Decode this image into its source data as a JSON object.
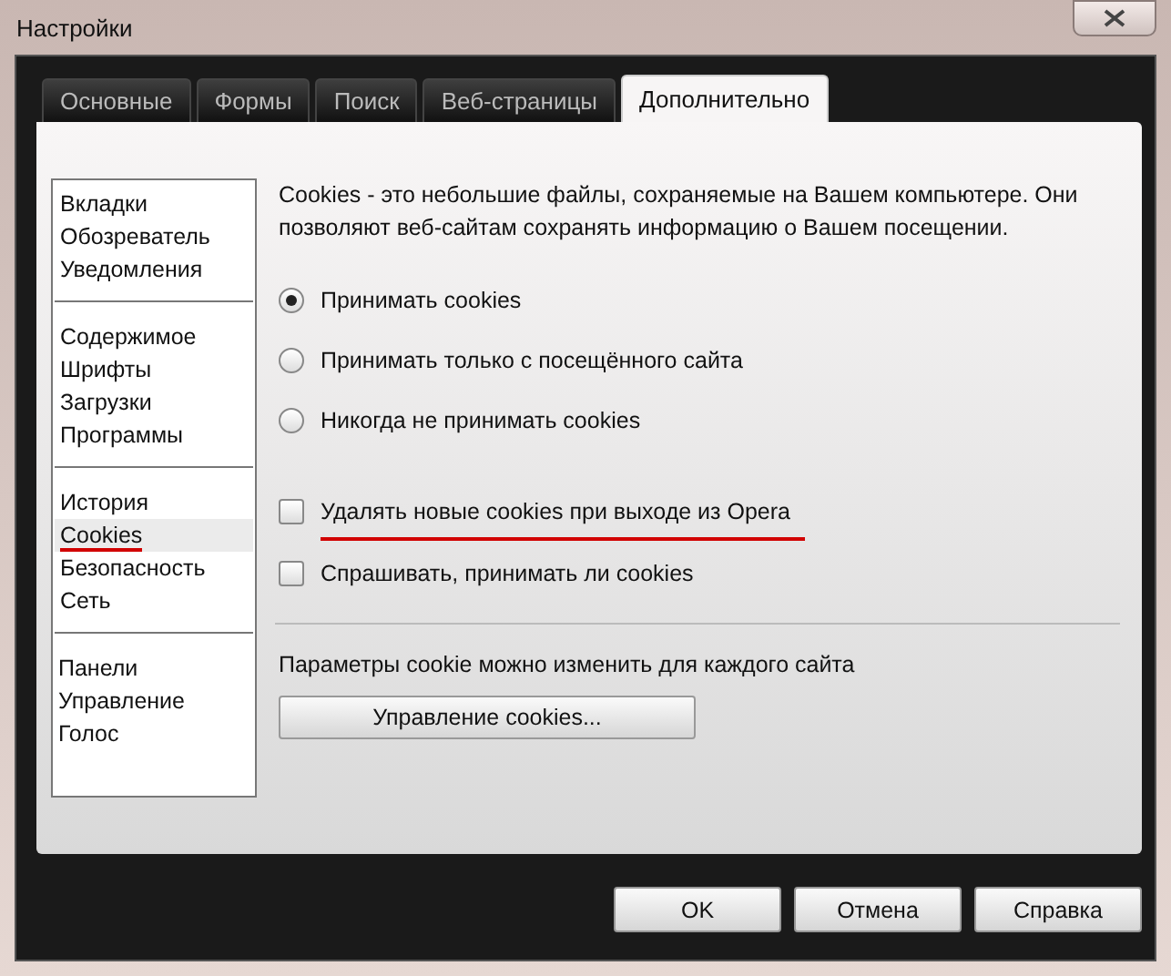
{
  "window": {
    "title": "Настройки"
  },
  "tabs": [
    {
      "label": "Основные",
      "selected": false
    },
    {
      "label": "Формы",
      "selected": false
    },
    {
      "label": "Поиск",
      "selected": false
    },
    {
      "label": "Веб-страницы",
      "selected": false
    },
    {
      "label": "Дополнительно",
      "selected": true
    }
  ],
  "sidebar": {
    "groups": [
      {
        "items": [
          {
            "label": "Вкладки",
            "selected": false,
            "underlined": false
          },
          {
            "label": "Обозреватель",
            "selected": false,
            "underlined": false
          },
          {
            "label": "Уведомления",
            "selected": false,
            "underlined": false
          }
        ]
      },
      {
        "items": [
          {
            "label": "Содержимое",
            "selected": false,
            "underlined": false
          },
          {
            "label": "Шрифты",
            "selected": false,
            "underlined": false
          },
          {
            "label": "Загрузки",
            "selected": false,
            "underlined": false
          },
          {
            "label": "Программы",
            "selected": false,
            "underlined": false
          }
        ]
      },
      {
        "items": [
          {
            "label": "История",
            "selected": false,
            "underlined": false
          },
          {
            "label": "Cookies",
            "selected": true,
            "underlined": true
          },
          {
            "label": "Безопасность",
            "selected": false,
            "underlined": false
          },
          {
            "label": "Сеть",
            "selected": false,
            "underlined": false
          }
        ]
      },
      {
        "items": [
          {
            "label": "Панели",
            "selected": false,
            "underlined": false
          },
          {
            "label": "Управление",
            "selected": false,
            "underlined": false
          },
          {
            "label": "Голос",
            "selected": false,
            "underlined": false
          }
        ]
      }
    ]
  },
  "content": {
    "description": "Cookies - это небольшие файлы, сохраняемые на Вашем компьютере. Они позволяют веб-сайтам сохранять информацию о Вашем посещении.",
    "radios": [
      {
        "label": "Принимать cookies",
        "selected": true
      },
      {
        "label": "Принимать только с посещённого сайта",
        "selected": false
      },
      {
        "label": "Никогда не принимать cookies",
        "selected": false
      }
    ],
    "checkboxes": [
      {
        "label": "Удалять новые cookies при выходе из Opera",
        "checked": false,
        "underlined": true
      },
      {
        "label": "Спрашивать, принимать ли cookies",
        "checked": false,
        "underlined": false
      }
    ],
    "note": "Параметры cookie можно изменить для каждого сайта",
    "manage_button": "Управление cookies..."
  },
  "buttons": [
    "OK",
    "Отмена",
    "Справка"
  ]
}
